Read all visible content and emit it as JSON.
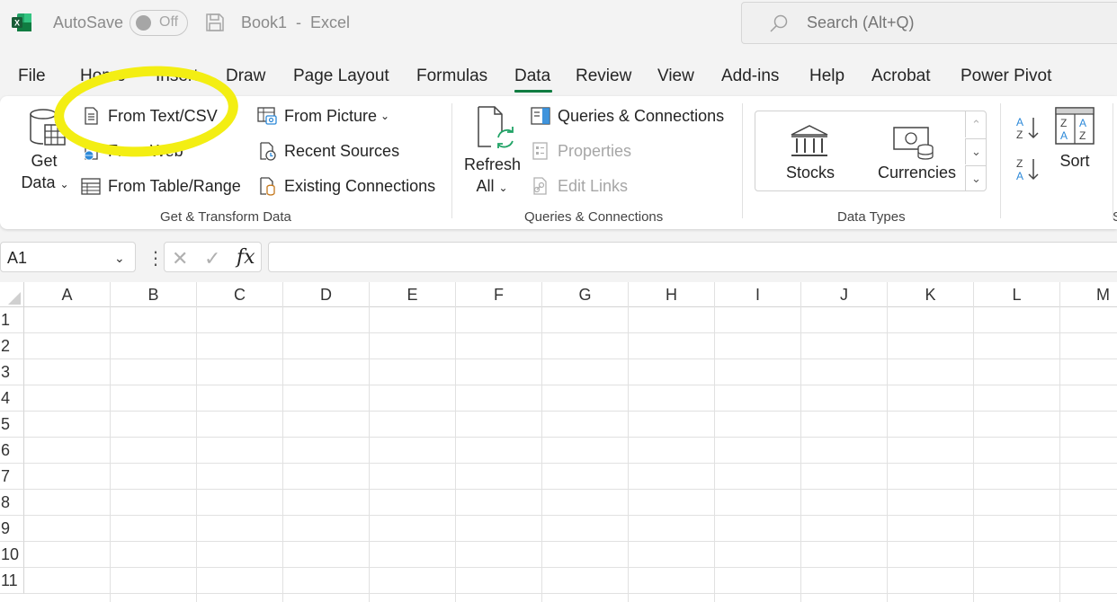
{
  "titlebar": {
    "autosave_label": "AutoSave",
    "autosave_state": "Off",
    "doc_title": "Book1  -  Excel",
    "search_placeholder": "Search (Alt+Q)"
  },
  "tabs": [
    "File",
    "Home",
    "Insert",
    "Draw",
    "Page Layout",
    "Formulas",
    "Data",
    "Review",
    "View",
    "Add-ins",
    "Help",
    "Acrobat",
    "Power Pivot"
  ],
  "active_tab": "Data",
  "ribbon": {
    "get_transform": {
      "get_data_line1": "Get",
      "get_data_line2": "Data",
      "from_text_csv": "From Text/CSV",
      "from_web": "From Web",
      "from_table_range": "From Table/Range",
      "from_picture": "From Picture",
      "recent_sources": "Recent Sources",
      "existing_connections": "Existing Connections",
      "group_label": "Get & Transform Data"
    },
    "queries": {
      "refresh_line1": "Refresh",
      "refresh_line2": "All",
      "queries_connections": "Queries & Connections",
      "properties": "Properties",
      "edit_links": "Edit Links",
      "group_label": "Queries & Connections"
    },
    "data_types": {
      "stocks": "Stocks",
      "currencies": "Currencies",
      "group_label": "Data Types"
    },
    "sort_filter": {
      "sort": "Sort",
      "group_label_partial": "S"
    }
  },
  "formula_bar": {
    "name_box": "A1",
    "fx": "fx",
    "formula": ""
  },
  "grid": {
    "columns": [
      "A",
      "B",
      "C",
      "D",
      "E",
      "F",
      "G",
      "H",
      "I",
      "J",
      "K",
      "L",
      "M"
    ],
    "rows": [
      "1",
      "2",
      "3",
      "4",
      "5",
      "6",
      "7",
      "8",
      "9",
      "10",
      "11"
    ]
  },
  "colors": {
    "excel_green": "#107c41",
    "highlight_yellow": "#f3ee13"
  }
}
